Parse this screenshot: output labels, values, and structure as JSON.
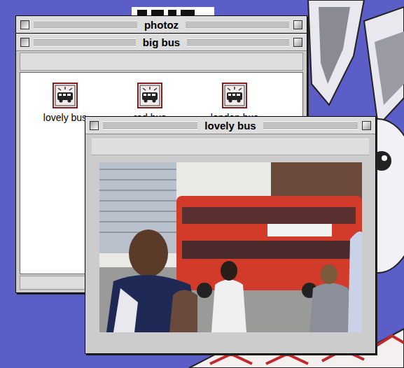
{
  "windows": [
    {
      "title": "photoz"
    },
    {
      "title": "big bus",
      "icons": [
        {
          "label": "lovely bus"
        },
        {
          "label": "red bus"
        },
        {
          "label": "london bus"
        }
      ]
    },
    {
      "title": "lovely bus"
    }
  ]
}
